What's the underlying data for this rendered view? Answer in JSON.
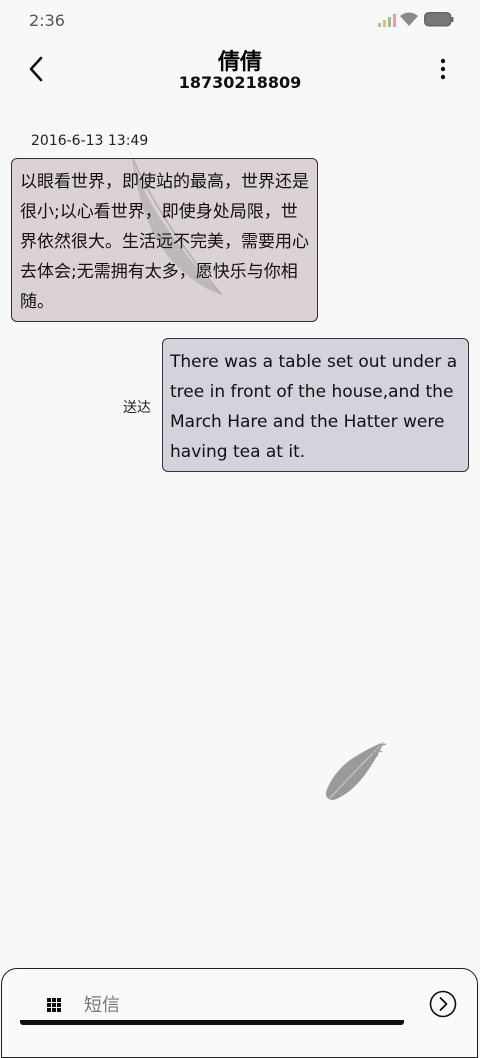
{
  "status_bar": {
    "time": "2:36"
  },
  "header": {
    "contact_name": "倩倩",
    "contact_number": "18730218809"
  },
  "conversation": {
    "timestamp": "2016-6-13 13:49",
    "messages": [
      {
        "direction": "received",
        "text": "以眼看世界，即使站的最高，世界还是很小;以心看世界，即使身处局限，世界依然很大。生活远不完美，需要用心去体会;无需拥有太多，愿快乐与你相随。"
      },
      {
        "direction": "sent",
        "text": "There was a table set out under a tree in front of the house,and the March Hare and the Hatter were having tea at it.",
        "status": "送达"
      }
    ]
  },
  "compose": {
    "placeholder": "短信",
    "value": ""
  },
  "icons": {
    "back": "chevron-left-icon",
    "more": "more-vertical-icon",
    "apps": "grid-icon",
    "send": "send-arrow-icon",
    "decoration": "feather-icon"
  },
  "colors": {
    "background": "#f8f8f8",
    "received_bubble": "#dbd3d3",
    "sent_bubble": "#d2d3db",
    "feather": "#9a9a9a"
  }
}
